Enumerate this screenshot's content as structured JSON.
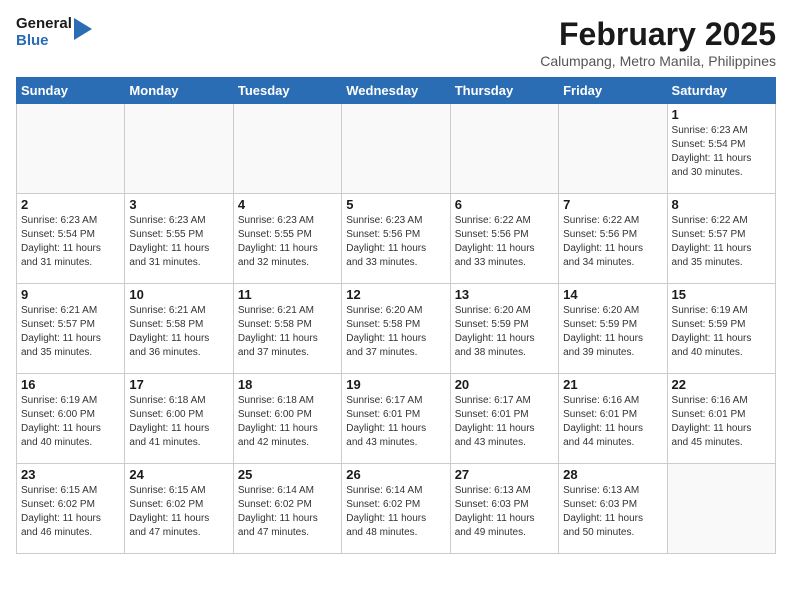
{
  "header": {
    "logo_line1": "General",
    "logo_line2": "Blue",
    "title": "February 2025",
    "subtitle": "Calumpang, Metro Manila, Philippines"
  },
  "weekdays": [
    "Sunday",
    "Monday",
    "Tuesday",
    "Wednesday",
    "Thursday",
    "Friday",
    "Saturday"
  ],
  "weeks": [
    [
      {
        "day": "",
        "info": ""
      },
      {
        "day": "",
        "info": ""
      },
      {
        "day": "",
        "info": ""
      },
      {
        "day": "",
        "info": ""
      },
      {
        "day": "",
        "info": ""
      },
      {
        "day": "",
        "info": ""
      },
      {
        "day": "1",
        "info": "Sunrise: 6:23 AM\nSunset: 5:54 PM\nDaylight: 11 hours\nand 30 minutes."
      }
    ],
    [
      {
        "day": "2",
        "info": "Sunrise: 6:23 AM\nSunset: 5:54 PM\nDaylight: 11 hours\nand 31 minutes."
      },
      {
        "day": "3",
        "info": "Sunrise: 6:23 AM\nSunset: 5:55 PM\nDaylight: 11 hours\nand 31 minutes."
      },
      {
        "day": "4",
        "info": "Sunrise: 6:23 AM\nSunset: 5:55 PM\nDaylight: 11 hours\nand 32 minutes."
      },
      {
        "day": "5",
        "info": "Sunrise: 6:23 AM\nSunset: 5:56 PM\nDaylight: 11 hours\nand 33 minutes."
      },
      {
        "day": "6",
        "info": "Sunrise: 6:22 AM\nSunset: 5:56 PM\nDaylight: 11 hours\nand 33 minutes."
      },
      {
        "day": "7",
        "info": "Sunrise: 6:22 AM\nSunset: 5:56 PM\nDaylight: 11 hours\nand 34 minutes."
      },
      {
        "day": "8",
        "info": "Sunrise: 6:22 AM\nSunset: 5:57 PM\nDaylight: 11 hours\nand 35 minutes."
      }
    ],
    [
      {
        "day": "9",
        "info": "Sunrise: 6:21 AM\nSunset: 5:57 PM\nDaylight: 11 hours\nand 35 minutes."
      },
      {
        "day": "10",
        "info": "Sunrise: 6:21 AM\nSunset: 5:58 PM\nDaylight: 11 hours\nand 36 minutes."
      },
      {
        "day": "11",
        "info": "Sunrise: 6:21 AM\nSunset: 5:58 PM\nDaylight: 11 hours\nand 37 minutes."
      },
      {
        "day": "12",
        "info": "Sunrise: 6:20 AM\nSunset: 5:58 PM\nDaylight: 11 hours\nand 37 minutes."
      },
      {
        "day": "13",
        "info": "Sunrise: 6:20 AM\nSunset: 5:59 PM\nDaylight: 11 hours\nand 38 minutes."
      },
      {
        "day": "14",
        "info": "Sunrise: 6:20 AM\nSunset: 5:59 PM\nDaylight: 11 hours\nand 39 minutes."
      },
      {
        "day": "15",
        "info": "Sunrise: 6:19 AM\nSunset: 5:59 PM\nDaylight: 11 hours\nand 40 minutes."
      }
    ],
    [
      {
        "day": "16",
        "info": "Sunrise: 6:19 AM\nSunset: 6:00 PM\nDaylight: 11 hours\nand 40 minutes."
      },
      {
        "day": "17",
        "info": "Sunrise: 6:18 AM\nSunset: 6:00 PM\nDaylight: 11 hours\nand 41 minutes."
      },
      {
        "day": "18",
        "info": "Sunrise: 6:18 AM\nSunset: 6:00 PM\nDaylight: 11 hours\nand 42 minutes."
      },
      {
        "day": "19",
        "info": "Sunrise: 6:17 AM\nSunset: 6:01 PM\nDaylight: 11 hours\nand 43 minutes."
      },
      {
        "day": "20",
        "info": "Sunrise: 6:17 AM\nSunset: 6:01 PM\nDaylight: 11 hours\nand 43 minutes."
      },
      {
        "day": "21",
        "info": "Sunrise: 6:16 AM\nSunset: 6:01 PM\nDaylight: 11 hours\nand 44 minutes."
      },
      {
        "day": "22",
        "info": "Sunrise: 6:16 AM\nSunset: 6:01 PM\nDaylight: 11 hours\nand 45 minutes."
      }
    ],
    [
      {
        "day": "23",
        "info": "Sunrise: 6:15 AM\nSunset: 6:02 PM\nDaylight: 11 hours\nand 46 minutes."
      },
      {
        "day": "24",
        "info": "Sunrise: 6:15 AM\nSunset: 6:02 PM\nDaylight: 11 hours\nand 47 minutes."
      },
      {
        "day": "25",
        "info": "Sunrise: 6:14 AM\nSunset: 6:02 PM\nDaylight: 11 hours\nand 47 minutes."
      },
      {
        "day": "26",
        "info": "Sunrise: 6:14 AM\nSunset: 6:02 PM\nDaylight: 11 hours\nand 48 minutes."
      },
      {
        "day": "27",
        "info": "Sunrise: 6:13 AM\nSunset: 6:03 PM\nDaylight: 11 hours\nand 49 minutes."
      },
      {
        "day": "28",
        "info": "Sunrise: 6:13 AM\nSunset: 6:03 PM\nDaylight: 11 hours\nand 50 minutes."
      },
      {
        "day": "",
        "info": ""
      }
    ]
  ]
}
